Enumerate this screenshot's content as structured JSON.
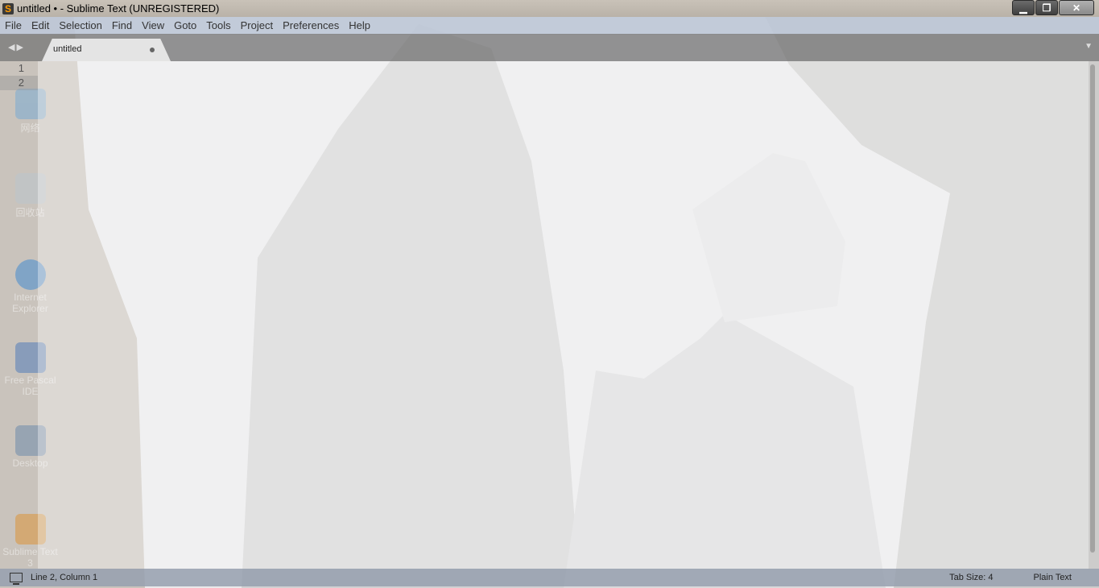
{
  "window": {
    "title": "untitled • - Sublime Text (UNREGISTERED)",
    "controls": {
      "minimize": "▁",
      "maximize": "❐",
      "close": "✕"
    }
  },
  "menu": [
    "File",
    "Edit",
    "Selection",
    "Find",
    "View",
    "Goto",
    "Tools",
    "Project",
    "Preferences",
    "Help"
  ],
  "tabs": [
    {
      "label": "untitled",
      "dirty": true
    }
  ],
  "gutter": {
    "lines": [
      "1",
      "2"
    ],
    "active_line": 2
  },
  "desktop_icons": [
    "网络",
    "回收站",
    "Internet Explorer",
    "Free Pascal IDE",
    "Desktop",
    "Sublime Text 3"
  ],
  "status": {
    "position": "Line 2, Column 1",
    "tab_size": "Tab Size: 4",
    "syntax": "Plain Text"
  },
  "colors": {
    "accent_icon": "#ff9a00",
    "tab_bg": "#ebebeb",
    "statusbar": "#96a0af"
  }
}
